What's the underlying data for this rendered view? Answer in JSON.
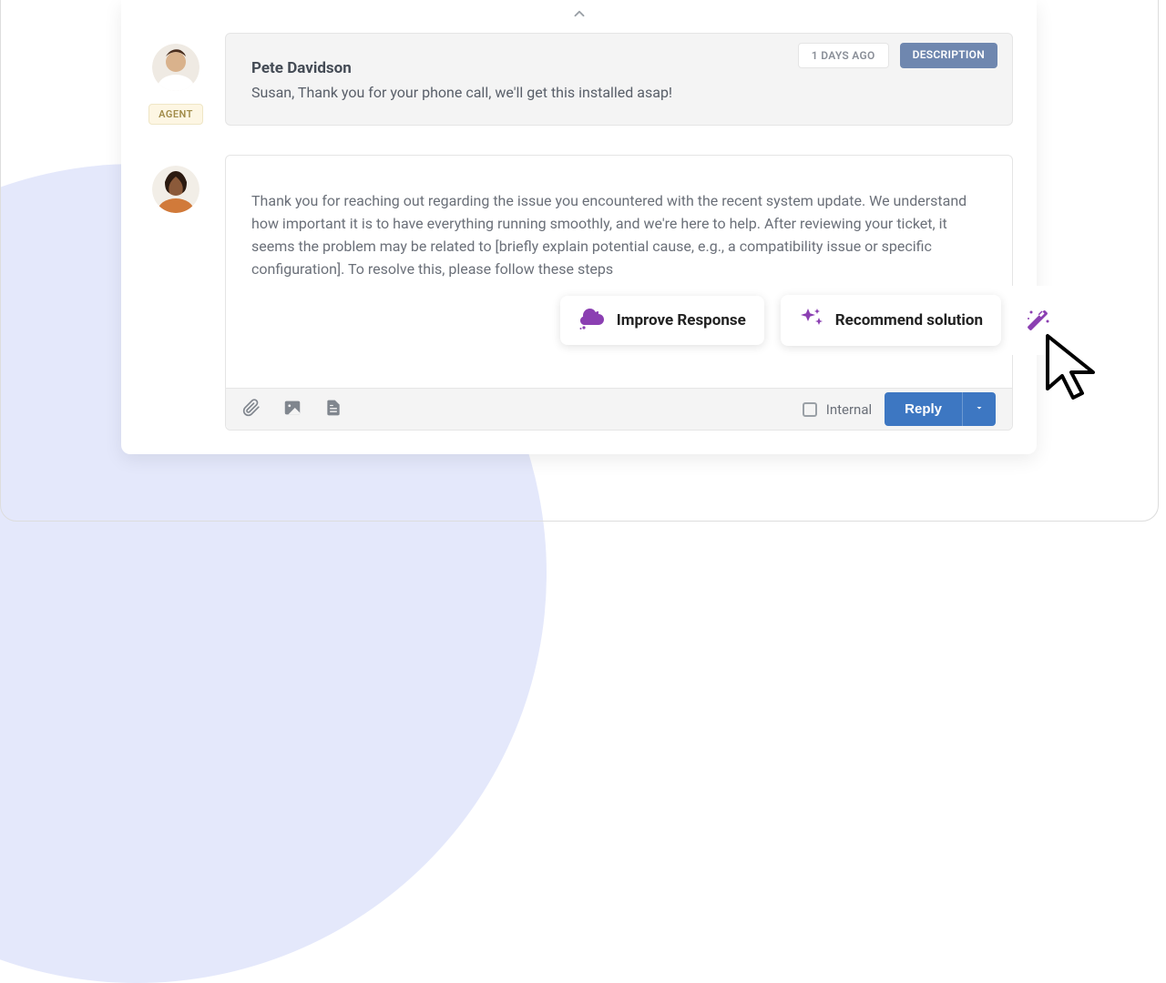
{
  "message": {
    "time_label": "1 DAYS AGO",
    "type_label": "DESCRIPTION",
    "author": "Pete Davidson",
    "text": "Susan, Thank you for your phone call, we'll get this installed asap!",
    "role_badge": "AGENT"
  },
  "editor": {
    "draft": "Thank you for reaching out regarding the issue you encountered with the recent system update. We understand how important it is to have everything running smoothly, and we're here to help. After reviewing your ticket, it seems the problem may be related to [briefly explain potential cause, e.g., a compatibility issue or specific configuration]. To resolve this, please follow these steps",
    "internal_label": "Internal",
    "reply_label": "Reply"
  },
  "ai": {
    "improve_label": "Improve Response",
    "recommend_label": "Recommend solution"
  }
}
